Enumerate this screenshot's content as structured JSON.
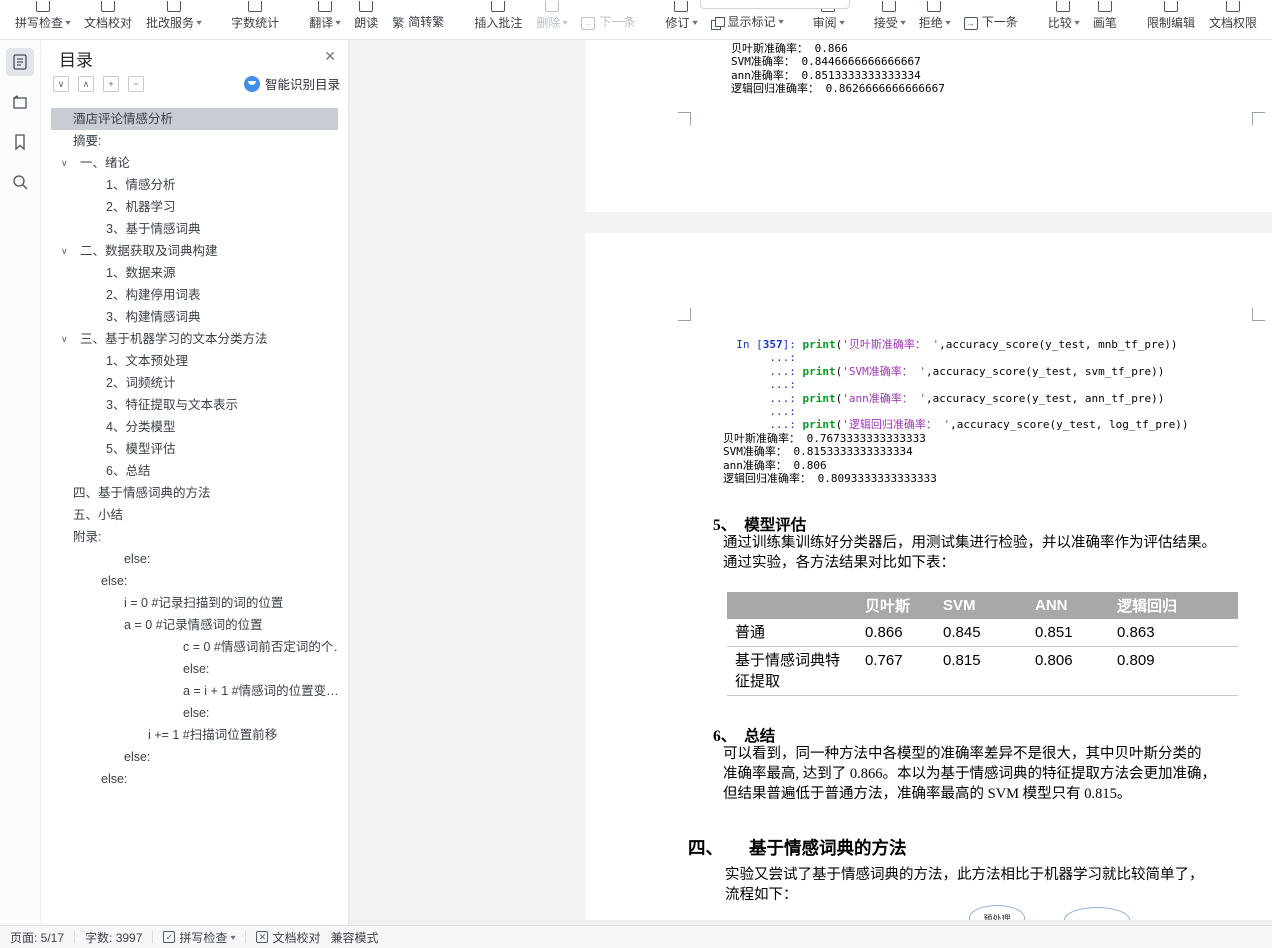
{
  "toolbar": {
    "groups": [
      {
        "items": [
          {
            "label": "拼写检查",
            "icon": "spellcheck",
            "dd": true
          },
          {
            "label": "文档校对",
            "icon": "document-proofing"
          },
          {
            "label": "批改服务",
            "icon": "correction-service",
            "dd": true
          }
        ]
      },
      {
        "items": [
          {
            "label": "字数统计",
            "icon": "word-count"
          }
        ]
      },
      {
        "items": [
          {
            "label": "翻译",
            "icon": "translate",
            "dd": true
          },
          {
            "label": "朗读",
            "icon": "read-aloud"
          },
          {
            "label": "简转繁",
            "icon": "simplified-to-traditional",
            "inline": "zh"
          }
        ]
      },
      {
        "items": [
          {
            "label": "插入批注",
            "icon": "insert-comment"
          },
          {
            "label": "删除",
            "icon": "delete-comment",
            "dd": true,
            "disabled": true
          },
          {
            "label": "下一条",
            "icon": "next-comment",
            "inline": "arrow",
            "disabled": true
          }
        ]
      },
      {
        "items": [
          {
            "label": "修订",
            "icon": "track-changes",
            "dd": true
          },
          {
            "label": "显示标记",
            "icon": "show-markup",
            "dd": true,
            "inline": "layers"
          }
        ]
      },
      {
        "items": [
          {
            "label": "审阅",
            "icon": "review-mode",
            "dd": true
          }
        ]
      },
      {
        "items": [
          {
            "label": "接受",
            "icon": "accept-change",
            "dd": true
          },
          {
            "label": "拒绝",
            "icon": "reject-change",
            "dd": true
          },
          {
            "label": "下一条",
            "icon": "next-change",
            "inline": "arrow"
          }
        ]
      },
      {
        "items": [
          {
            "label": "比较",
            "icon": "compare",
            "dd": true
          },
          {
            "label": "画笔",
            "icon": "ink-pen"
          }
        ]
      },
      {
        "items": [
          {
            "label": "限制编辑",
            "icon": "restrict-editing"
          },
          {
            "label": "文档权限",
            "icon": "document-permission"
          }
        ]
      }
    ]
  },
  "sidebar": {
    "rail": [
      {
        "name": "outline",
        "active": true
      },
      {
        "name": "chapter-navigation",
        "active": false
      },
      {
        "name": "bookmark",
        "active": false
      },
      {
        "name": "search",
        "active": false
      }
    ],
    "panel": {
      "title": "目录",
      "close_glyph": "✕",
      "ctrl_glyphs": [
        "∨",
        "∧",
        "+",
        "−"
      ],
      "smart_label": "智能识别目录"
    },
    "toc": [
      {
        "t": "酒店评论情感分析",
        "d": 0,
        "active": true
      },
      {
        "t": "摘要:",
        "d": 0
      },
      {
        "t": "一、绪论",
        "d": 0,
        "chev": true
      },
      {
        "t": "1、情感分析",
        "d": 1
      },
      {
        "t": "2、机器学习",
        "d": 1
      },
      {
        "t": "3、基于情感词典",
        "d": 1
      },
      {
        "t": "二、数据获取及词典构建",
        "d": 0,
        "chev": true
      },
      {
        "t": "1、数据来源",
        "d": 1
      },
      {
        "t": "2、构建停用词表",
        "d": 1
      },
      {
        "t": "3、构建情感词典",
        "d": 1
      },
      {
        "t": "三、基于机器学习的文本分类方法",
        "d": 0,
        "chev": true
      },
      {
        "t": "1、文本预处理",
        "d": 1
      },
      {
        "t": "2、词频统计",
        "d": 1
      },
      {
        "t": "3、特征提取与文本表示",
        "d": 1
      },
      {
        "t": "4、分类模型",
        "d": 1
      },
      {
        "t": "5、模型评估",
        "d": 1
      },
      {
        "t": "6、总结",
        "d": 1
      },
      {
        "t": "四、基于情感词典的方法",
        "d": 0
      },
      {
        "t": "五、小结",
        "d": 0
      },
      {
        "t": "附录:",
        "d": 0
      },
      {
        "t": "else:",
        "d": 3
      },
      {
        "t": "else:",
        "d": 2
      },
      {
        "t": "i = 0 #记录扫描到的词的位置",
        "d": 3
      },
      {
        "t": "a = 0 #记录情感词的位置",
        "d": 3
      },
      {
        "t": "c = 0 #情感词前否定词的个…",
        "d": 5
      },
      {
        "t": "else:",
        "d": 5
      },
      {
        "t": "a = i + 1 #情感词的位置变…",
        "d": 5
      },
      {
        "t": "else:",
        "d": 5
      },
      {
        "t": "i += 1 #扫描词位置前移",
        "d": 4
      },
      {
        "t": "else:",
        "d": 3
      },
      {
        "t": "else:",
        "d": 2
      }
    ]
  },
  "document": {
    "page4_lines": [
      "贝叶斯准确率： 0.866",
      "SVM准确率： 0.8446666666666667",
      "ann准确率： 0.8513333333333334",
      "逻辑回归准确率： 0.8626666666666667"
    ],
    "code_lines": [
      [
        [
          "p",
          "  In ["
        ],
        [
          "pb",
          "357"
        ],
        [
          "p",
          "]: "
        ],
        [
          "k",
          "print"
        ],
        [
          "t",
          "("
        ],
        [
          "s",
          "'贝叶斯准确率： '"
        ],
        [
          "t",
          ",accuracy_score(y_test, mnb_tf_pre))"
        ]
      ],
      [
        [
          "p",
          "       ...:"
        ]
      ],
      [
        [
          "p",
          "       ...: "
        ],
        [
          "k",
          "print"
        ],
        [
          "t",
          "("
        ],
        [
          "s",
          "'SVM准确率： '"
        ],
        [
          "t",
          ",accuracy_score(y_test, svm_tf_pre))"
        ]
      ],
      [
        [
          "p",
          "       ...:"
        ]
      ],
      [
        [
          "p",
          "       ...: "
        ],
        [
          "k",
          "print"
        ],
        [
          "t",
          "("
        ],
        [
          "s",
          "'ann准确率： '"
        ],
        [
          "t",
          ",accuracy_score(y_test, ann_tf_pre))"
        ]
      ],
      [
        [
          "p",
          "       ...:"
        ]
      ],
      [
        [
          "p",
          "       ...: "
        ],
        [
          "k",
          "print"
        ],
        [
          "t",
          "("
        ],
        [
          "s",
          "'逻辑回归准确率： '"
        ],
        [
          "t",
          ",accuracy_score(y_test, log_tf_pre))"
        ]
      ],
      [
        [
          "t",
          "贝叶斯准确率： 0.7673333333333333"
        ]
      ],
      [
        [
          "t",
          "SVM准确率： 0.8153333333333334"
        ]
      ],
      [
        [
          "t",
          "ann准确率： 0.806"
        ]
      ],
      [
        [
          "t",
          "逻辑回归准确率： 0.8093333333333333"
        ]
      ]
    ],
    "section5": {
      "num": "5、",
      "title": "模型评估",
      "lines": [
        "通过训练集训练好分类器后，用测试集进行检验，并以准确率作为评估结果。",
        "通过实验，各方法结果对比如下表："
      ]
    },
    "table": {
      "headers": [
        "",
        "贝叶斯",
        "SVM",
        "ANN",
        "逻辑回归"
      ],
      "rows": [
        {
          "label": "普通",
          "label_red": true,
          "values": [
            {
              "v": "0.866",
              "red": true
            },
            {
              "v": "0.845"
            },
            {
              "v": "0.851"
            },
            {
              "v": "0.863"
            }
          ]
        },
        {
          "label": "基于情感词典特征提取",
          "label_red": false,
          "values": [
            {
              "v": "0.767"
            },
            {
              "v": "0.815",
              "red": true
            },
            {
              "v": "0.806"
            },
            {
              "v": "0.809"
            }
          ]
        }
      ]
    },
    "section6": {
      "num": "6、",
      "title": "总结",
      "lines": [
        "可以看到，同一种方法中各模型的准确率差异不是很大，其中贝叶斯分类的",
        "准确率最高, 达到了 0.866。本以为基于情感词典的特征提取方法会更加准确，",
        "但结果普遍低于普通方法，准确率最高的 SVM 模型只有 0.815。"
      ]
    },
    "section4": {
      "num": "四、",
      "title": "基于情感词典的方法",
      "lines": [
        "实验又尝试了基于情感词典的方法，此方法相比于机器学习就比较简单了，",
        "流程如下："
      ]
    },
    "flow_ellipse_label": "预处理"
  },
  "statusbar": {
    "page": "页面: 5/17",
    "words": "字数: 3997",
    "spellcheck": "拼写检查",
    "proofing": "文档校对",
    "mode": "兼容模式"
  },
  "colors": {
    "accent_blue": "#3f8ee8",
    "red": "#ee1111",
    "table_header_bg": "#a8a8a8",
    "toc_highlight": "#c9cdd3",
    "code_prompt": "#1a35c8",
    "code_keyword": "#0a9a2a",
    "code_string": "#9c36b5"
  }
}
